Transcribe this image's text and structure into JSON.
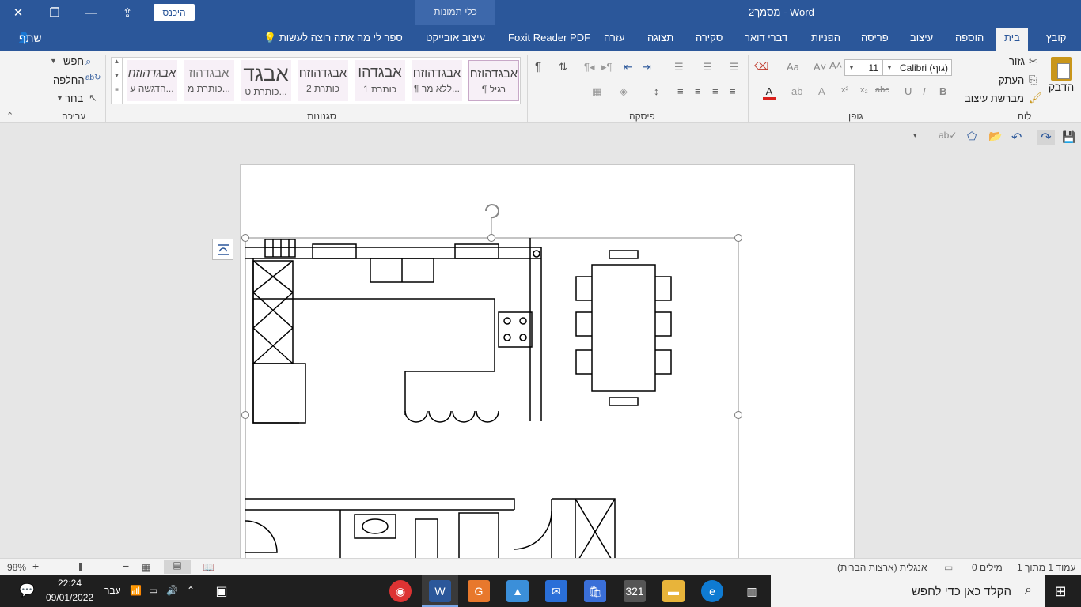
{
  "titlebar": {
    "doc_title": "מסמך2 - Word",
    "signin_label": "היכנס",
    "context_header": "כלי תמונות"
  },
  "tabs": [
    {
      "label": "קובץ"
    },
    {
      "label": "בית"
    },
    {
      "label": "הוספה"
    },
    {
      "label": "עיצוב"
    },
    {
      "label": "פריסה"
    },
    {
      "label": "הפניות"
    },
    {
      "label": "דברי דואר"
    },
    {
      "label": "סקירה"
    },
    {
      "label": "תצוגה"
    },
    {
      "label": "עזרה"
    },
    {
      "label": "Foxit Reader PDF"
    },
    {
      "label": "עיצוב אובייקט"
    }
  ],
  "tellme": "ספר לי מה אתה רוצה לעשות",
  "share": "שתף",
  "clipboard": {
    "paste": "הדבק",
    "cut": "גזור",
    "copy": "העתק",
    "format_painter": "מברשת עיצוב",
    "group_label": "לוח"
  },
  "font": {
    "name": "Calibri (גוף)",
    "size": "11",
    "group_label": "גופן"
  },
  "paragraph": {
    "group_label": "פיסקה"
  },
  "styles": {
    "group_label": "סגנונות",
    "items": [
      {
        "sample": "אבגדהוזח",
        "label": "¶ רגיל"
      },
      {
        "sample": "אבגדהוזח",
        "label": "¶ ללא מר..."
      },
      {
        "sample": "אבגדהו",
        "label": "כותרת 1"
      },
      {
        "sample": "אבגדהוזח",
        "label": "כותרת 2"
      },
      {
        "sample": "אבגד",
        "label": "כותרת ט..."
      },
      {
        "sample": "אבגדהוז",
        "label": "כותרת מ..."
      },
      {
        "sample": "אבגדהוזח",
        "label": "הדגשה ע..."
      }
    ]
  },
  "editing": {
    "find": "חפש",
    "replace": "החלפה",
    "select": "בחר",
    "group_label": "עריכה"
  },
  "statusbar": {
    "page": "עמוד 1 מתוך 1",
    "words": "0 מילים",
    "language": "אנגלית (ארצות הברית)",
    "zoom": "98%"
  },
  "taskbar": {
    "search_placeholder": "הקלד כאן כדי לחפש",
    "time": "22:24",
    "date": "09/01/2022",
    "lang": "עבר"
  }
}
